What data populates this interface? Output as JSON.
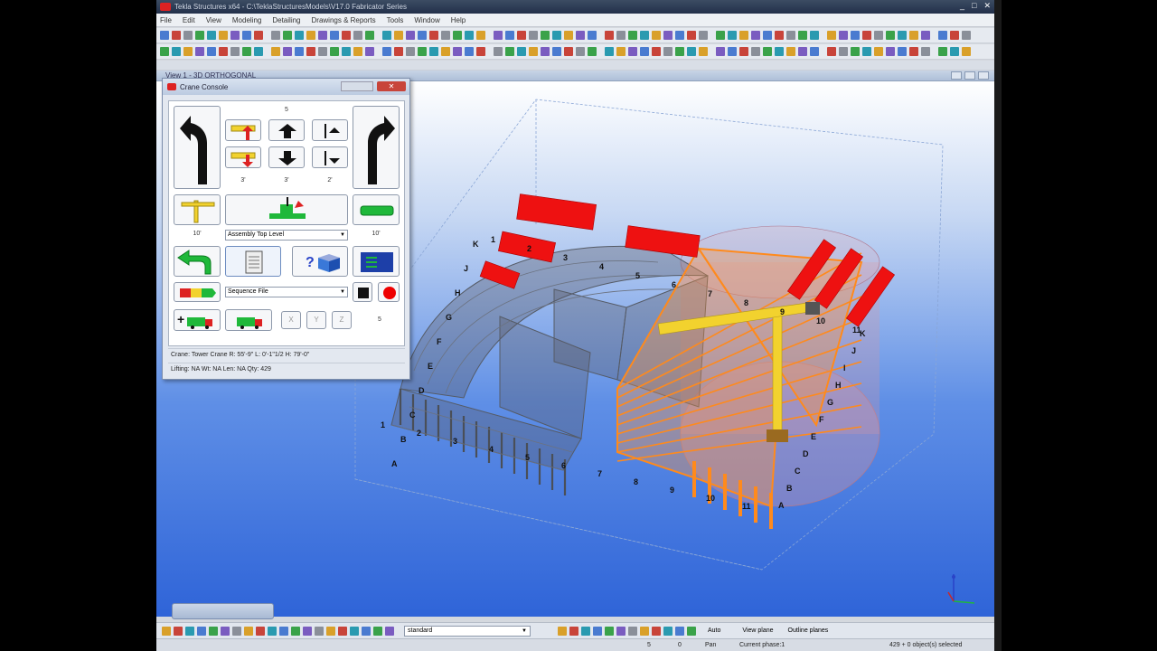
{
  "window": {
    "title": "Tekla Structures x64 - C:\\TeklaStructuresModels\\V17.0 Fabricator Series",
    "buttons": [
      "_",
      "□",
      "✕"
    ]
  },
  "menu": [
    "File",
    "Edit",
    "View",
    "Modeling",
    "Detailing",
    "Drawings & Reports",
    "Tools",
    "Window",
    "Help"
  ],
  "view_title": "View 1 - 3D ORTHOGONAL",
  "console": {
    "title": "Crane Console",
    "close_label": "✕",
    "top_value": "5",
    "row_values": [
      "3'",
      "3'",
      "2'"
    ],
    "left_value": "10'",
    "right_value": "10'",
    "assembly_select": "Assembly Top Level",
    "sequence_select": "Sequence File",
    "axis_buttons": [
      "X",
      "Y",
      "Z"
    ],
    "count_value": "5",
    "crane_status": "Crane:  Tower Crane  R:  55'-9\"  L:  0'-1\"1/2  H:  79'-0\"",
    "lifting_status": "Lifting:  NA  Wt:  NA  Len:  NA  Qty:  429"
  },
  "grid_labels": {
    "letters_left": [
      "K",
      "J",
      "H",
      "G",
      "F",
      "E",
      "D",
      "C",
      "B",
      "A"
    ],
    "numbers_front": [
      "1",
      "2",
      "3",
      "4",
      "5",
      "6",
      "7",
      "8",
      "9",
      "10",
      "11"
    ],
    "numbers_top": [
      "1",
      "2",
      "3",
      "4",
      "5",
      "6",
      "7",
      "8",
      "9",
      "10",
      "11"
    ],
    "letters_right": [
      "K",
      "J",
      "I",
      "H",
      "G",
      "F",
      "E",
      "D",
      "C",
      "B",
      "A"
    ]
  },
  "bottom_toolbar": {
    "filter_value": "standard",
    "snap_mode": "Auto",
    "plane_mode": "View plane",
    "outline_mode": "Outline planes"
  },
  "status": {
    "num_a": "5",
    "num_b": "0",
    "mode": "Pan",
    "phase": "Current phase:1",
    "selection": "429 + 0 object(s) selected"
  },
  "colors": {
    "accent": "#ff8a1c",
    "highlight_red": "#ee1111",
    "crane_yellow": "#f2d22e",
    "steel_gray": "#6a6a74"
  }
}
